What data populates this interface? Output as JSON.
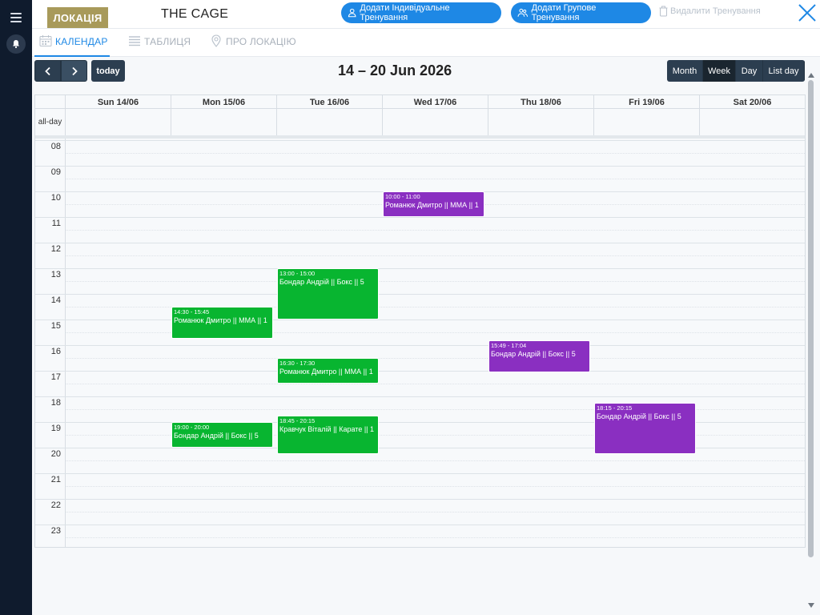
{
  "sidebar": {
    "menu_icon": "hamburger-icon",
    "notifications_icon": "bell-icon"
  },
  "header": {
    "location_badge": "ЛОКАЦІЯ",
    "location_name": "THE CAGE",
    "add_individual_label": "Додати Індивідуальне Тренування",
    "add_group_label": "Додати Групове Тренування",
    "delete_label": "Видалити Тренування",
    "close_icon": "close-icon"
  },
  "tabs": [
    {
      "label": "КАЛЕНДАР",
      "icon": "calendar-icon",
      "active": true
    },
    {
      "label": "ТАБЛИЦЯ",
      "icon": "table-icon",
      "active": false
    },
    {
      "label": "ПРО ЛОКАЦІЮ",
      "icon": "location-pin-icon",
      "active": false
    }
  ],
  "toolbar": {
    "prev_icon": "chevron-left-icon",
    "next_icon": "chevron-right-icon",
    "today_label": "today",
    "title": "14 – 20 Jun 2026",
    "views": [
      "Month",
      "Week",
      "Day",
      "List day"
    ],
    "active_view": "Week"
  },
  "calendar": {
    "allday_label": "all-day",
    "days": [
      "Sun 14/06",
      "Mon 15/06",
      "Tue 16/06",
      "Wed 17/06",
      "Thu 18/06",
      "Fri 19/06",
      "Sat 20/06"
    ],
    "hours": [
      "08",
      "09",
      "10",
      "11",
      "12",
      "13",
      "14",
      "15",
      "16",
      "17",
      "18",
      "19",
      "20",
      "21",
      "22",
      "23"
    ],
    "events": [
      {
        "day": 3,
        "start": "10:00",
        "end": "11:00",
        "time": "10:00 - 11:00",
        "title": "Романюк Дмитро || ММА || 1",
        "color": "#8a2fc1"
      },
      {
        "day": 2,
        "start": "13:00",
        "end": "15:00",
        "time": "13:00 - 15:00",
        "title": "Бондар Андрій || Бокс || 5",
        "color": "#08b530"
      },
      {
        "day": 1,
        "start": "14:30",
        "end": "15:45",
        "time": "14:30 - 15:45",
        "title": "Романюк Дмитро || ММА || 1",
        "color": "#08b530"
      },
      {
        "day": 4,
        "start": "15:49",
        "end": "17:04",
        "time": "15:49 - 17:04",
        "title": "Бондар Андрій || Бокс || 5",
        "color": "#8a2fc1"
      },
      {
        "day": 2,
        "start": "16:30",
        "end": "17:30",
        "time": "16:30 - 17:30",
        "title": "Романюк Дмитро || ММА || 1",
        "color": "#08b530"
      },
      {
        "day": 5,
        "start": "18:15",
        "end": "20:15",
        "time": "18:15 - 20:15",
        "title": "Бондар Андрій || Бокс || 5",
        "color": "#8a2fc1"
      },
      {
        "day": 1,
        "start": "19:00",
        "end": "20:00",
        "time": "19:00 - 20:00",
        "title": "Бондар Андрій || Бокс || 5",
        "color": "#08b530"
      },
      {
        "day": 2,
        "start": "18:45",
        "end": "20:15",
        "time": "18:45 - 20:15",
        "title": "Кравчук Віталій || Карате || 1",
        "color": "#08b530"
      }
    ]
  }
}
